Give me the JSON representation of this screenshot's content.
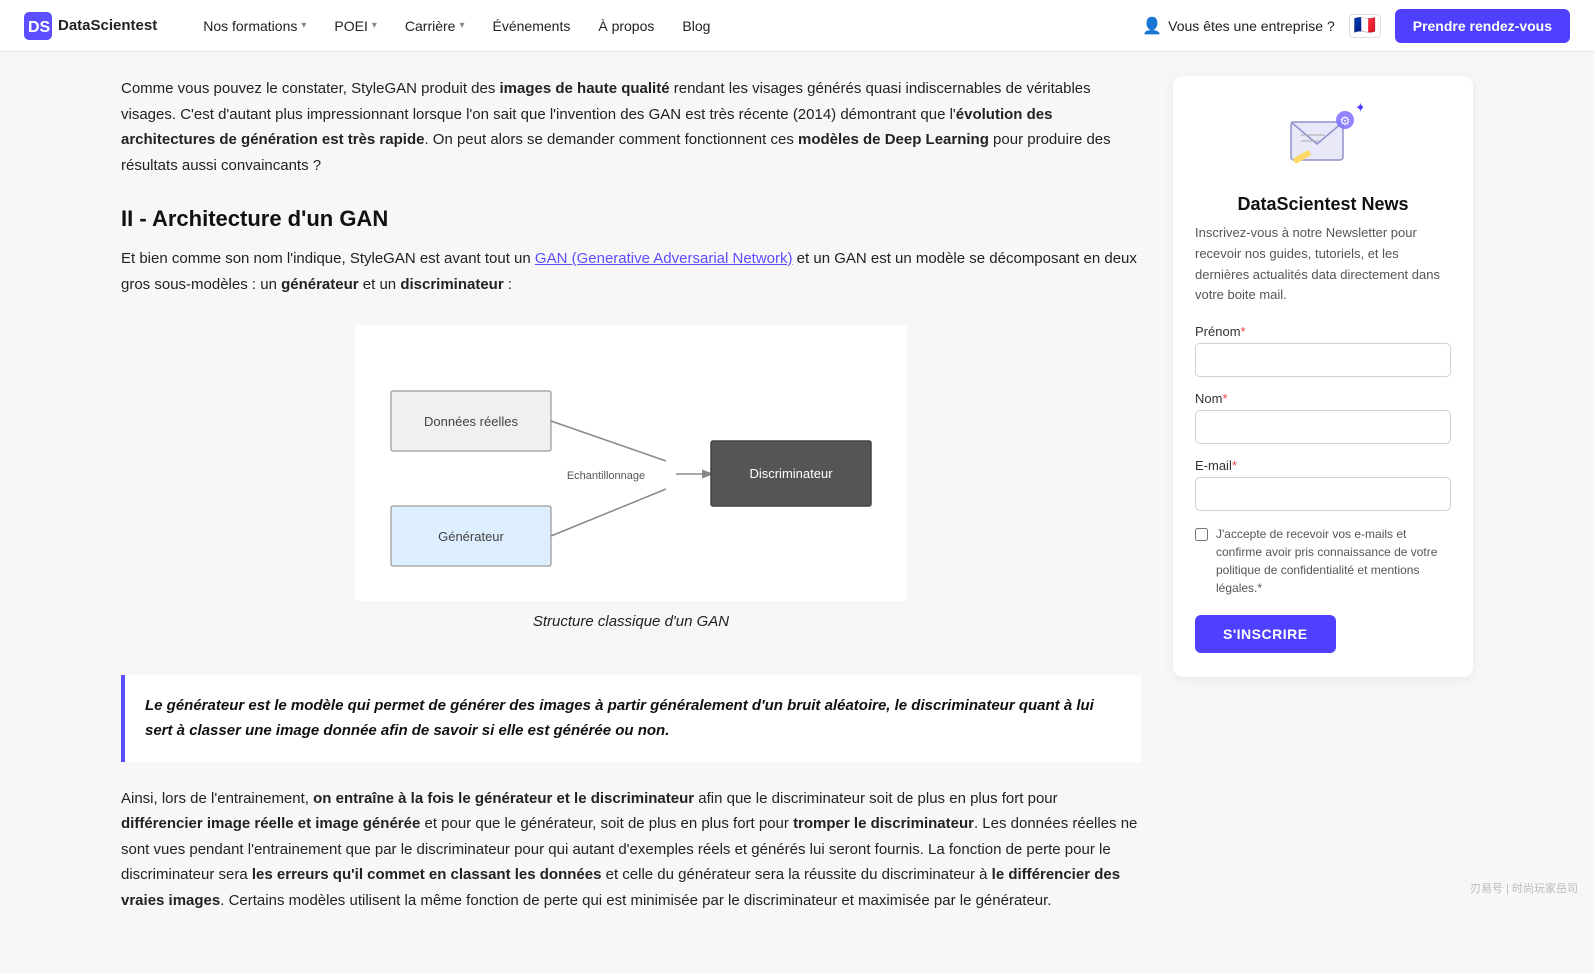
{
  "nav": {
    "logo_text": "DataScientest",
    "links": [
      {
        "label": "Nos formations",
        "has_dropdown": true
      },
      {
        "label": "POEI",
        "has_dropdown": true
      },
      {
        "label": "Carrière",
        "has_dropdown": true
      },
      {
        "label": "Événements",
        "has_dropdown": false
      },
      {
        "label": "À propos",
        "has_dropdown": false
      },
      {
        "label": "Blog",
        "has_dropdown": false
      }
    ],
    "enterprise_label": "Vous êtes une entreprise ?",
    "cta_label": "Prendre rendez-vous"
  },
  "article": {
    "paragraph1_pre": "Comme vous pouvez le constater, StyleGAN produit des ",
    "paragraph1_bold1": "images de haute qualité",
    "paragraph1_mid": " rendant les visages générés quasi indiscernables de véritables visages. C'est d'autant plus impressionnant lorsque l'on sait que l'invention des GAN est très récente (2014) démontrant que l'",
    "paragraph1_bold2": "évolution des architectures de génération est très rapide",
    "paragraph1_end": ". On peut alors se demander comment fonctionnent ces ",
    "paragraph1_bold3": "modèles de Deep Learning",
    "paragraph1_tail": " pour produire des résultats aussi convaincants ?",
    "section_title": "II - Architecture d'un GAN",
    "paragraph2_pre": "Et bien comme son nom l'indique, StyleGAN est avant tout un ",
    "paragraph2_link": "GAN (Generative Adversarial Network)",
    "paragraph2_mid": " et un GAN est un modèle se décomposant en deux gros sous-modèles : un ",
    "paragraph2_bold1": "générateur",
    "paragraph2_mid2": " et un ",
    "paragraph2_bold2": "discriminateur",
    "paragraph2_end": " :",
    "diagram_caption": "Structure classique d'un GAN",
    "diagram_nodes": {
      "donnees_reelles": "Données réelles",
      "generateur": "Générateur",
      "echantillonnage": "Echantillonnage",
      "discriminateur": "Discriminateur"
    },
    "blockquote": "Le générateur est le modèle qui permet de générer des images à partir généralement d'un bruit aléatoire, le discriminateur quant à lui sert à classer une image donnée afin de savoir si elle est générée ou non.",
    "paragraph3_pre": "Ainsi, lors de l'entrainement, ",
    "paragraph3_bold1": "on entraîne à la fois le générateur et le discriminateur",
    "paragraph3_mid": " afin que le discriminateur soit de plus en plus fort pour ",
    "paragraph3_bold2": "différencier image réelle et image générée",
    "paragraph3_mid2": " et pour que le générateur, soit de plus en plus fort pour ",
    "paragraph3_bold3": "tromper le discriminateur",
    "paragraph3_mid3": ". Les données réelles ne sont vues pendant l'entrainement que par le discriminateur pour qui autant d'exemples réels et générés lui seront fournis. La fonction de perte pour le discriminateur sera ",
    "paragraph3_bold4": "les erreurs qu'il commet en classant les données",
    "paragraph3_mid4": " et celle du générateur sera la réussite du discriminateur à ",
    "paragraph3_bold5": "le différencier des vraies images",
    "paragraph3_end": ". Certains modèles utilisent la même fonction de perte qui est minimisée par le discriminateur et maximisée par le générateur."
  },
  "sidebar": {
    "newsletter_title": "DataScientest News",
    "newsletter_desc": "Inscrivez-vous à notre Newsletter pour recevoir nos guides, tutoriels, et les dernières actualités data directement dans votre boite mail.",
    "form": {
      "prenom_label": "Prénom",
      "prenom_required": "*",
      "nom_label": "Nom",
      "nom_required": "*",
      "email_label": "E-mail",
      "email_required": "*",
      "checkbox_label": "J'accepte de recevoir vos e-mails et confirme avoir pris connaissance de votre politique de confidentialité et mentions légales.",
      "checkbox_required": "*",
      "submit_label": "S'INSCRIRE"
    }
  }
}
